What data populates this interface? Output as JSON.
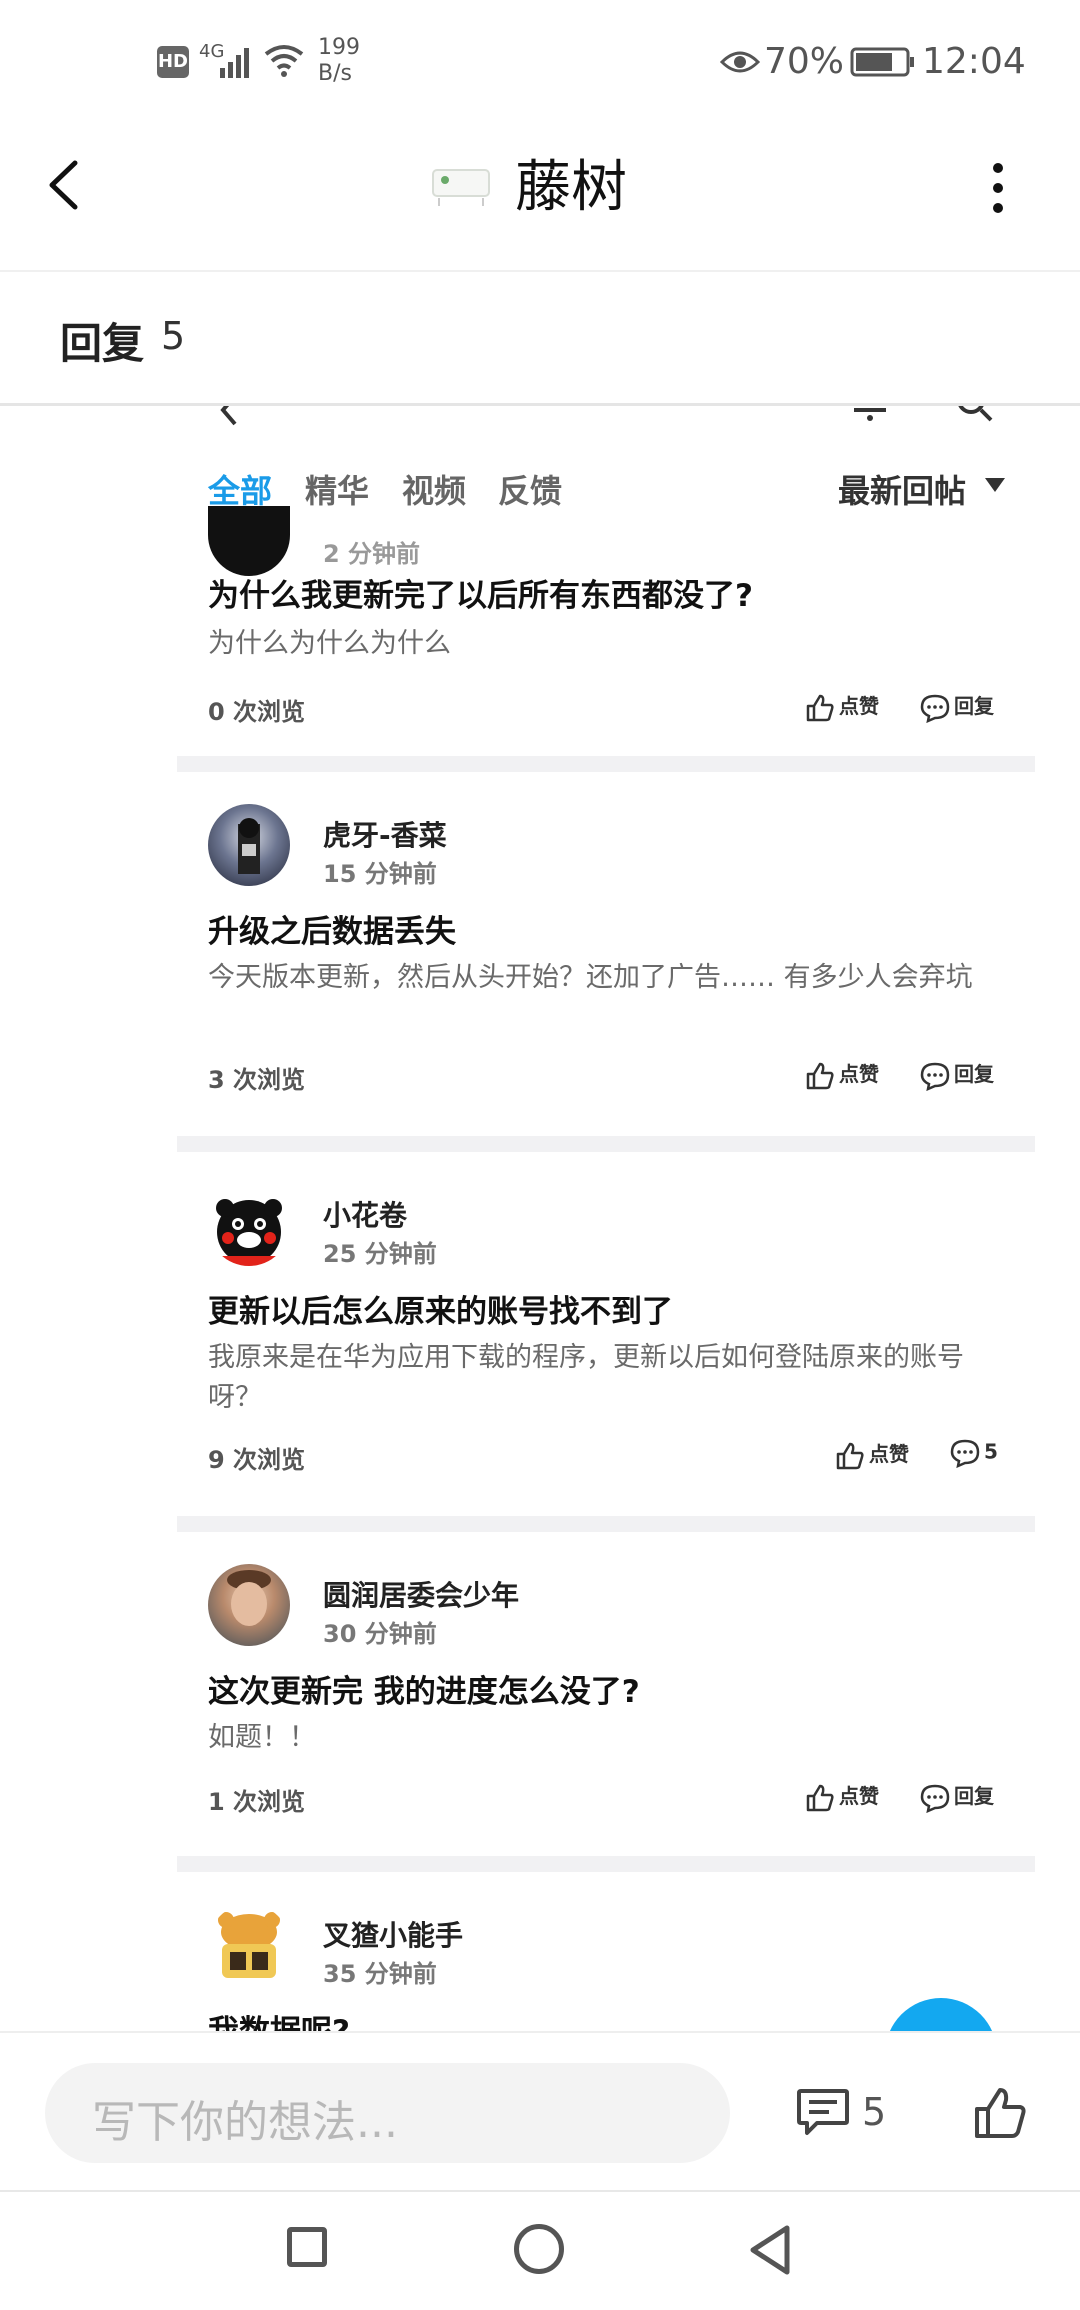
{
  "status_bar": {
    "hd": "HD",
    "network": "4G",
    "speed_value": "199",
    "speed_unit": "B/s",
    "battery": "70%",
    "time": "12:04"
  },
  "header": {
    "title": "藤树"
  },
  "reply_bar": {
    "label": "回复",
    "count": "5"
  },
  "embedded": {
    "tabs": [
      {
        "label": "全部",
        "active": true
      },
      {
        "label": "精华",
        "active": false
      },
      {
        "label": "视频",
        "active": false
      },
      {
        "label": "反馈",
        "active": false
      }
    ],
    "sort_label": "最新回帖",
    "posts": [
      {
        "author": "",
        "time": "",
        "title": "为什么我更新完了以后所有东西都没了?",
        "body": "为什么为什么为什么",
        "views": "0 次浏览",
        "like_label": "点赞",
        "reply_label": "回复"
      },
      {
        "author": "虎牙-香菜",
        "time": "15 分钟前",
        "title": "升级之后数据丢失",
        "body": "今天版本更新，然后从头开始？还加了广告…… 有多少人会弃坑",
        "views": "3 次浏览",
        "like_label": "点赞",
        "reply_label": "回复"
      },
      {
        "author": "小花卷",
        "time": "25 分钟前",
        "title": "更新以后怎么原来的账号找不到了",
        "body": "我原来是在华为应用下载的程序，更新以后如何登陆原来的账号呀？",
        "views": "9 次浏览",
        "like_label": "点赞",
        "reply_label": "5"
      },
      {
        "author": "圆润居委会少年",
        "time": "30 分钟前",
        "title": "这次更新完 我的进度怎么没了?",
        "body": "如题！！",
        "views": "1 次浏览",
        "like_label": "点赞",
        "reply_label": "回复"
      },
      {
        "author": "叉猹小能手",
        "time": "35 分钟前",
        "title": "我数据呢?",
        "body": "",
        "views": "",
        "like_label": "",
        "reply_label": ""
      }
    ]
  },
  "bottom_bar": {
    "input_placeholder": "写下你的想法...",
    "comment_count": "5"
  },
  "colors": {
    "accent": "#1a9be8",
    "fab": "#13a8f0"
  }
}
